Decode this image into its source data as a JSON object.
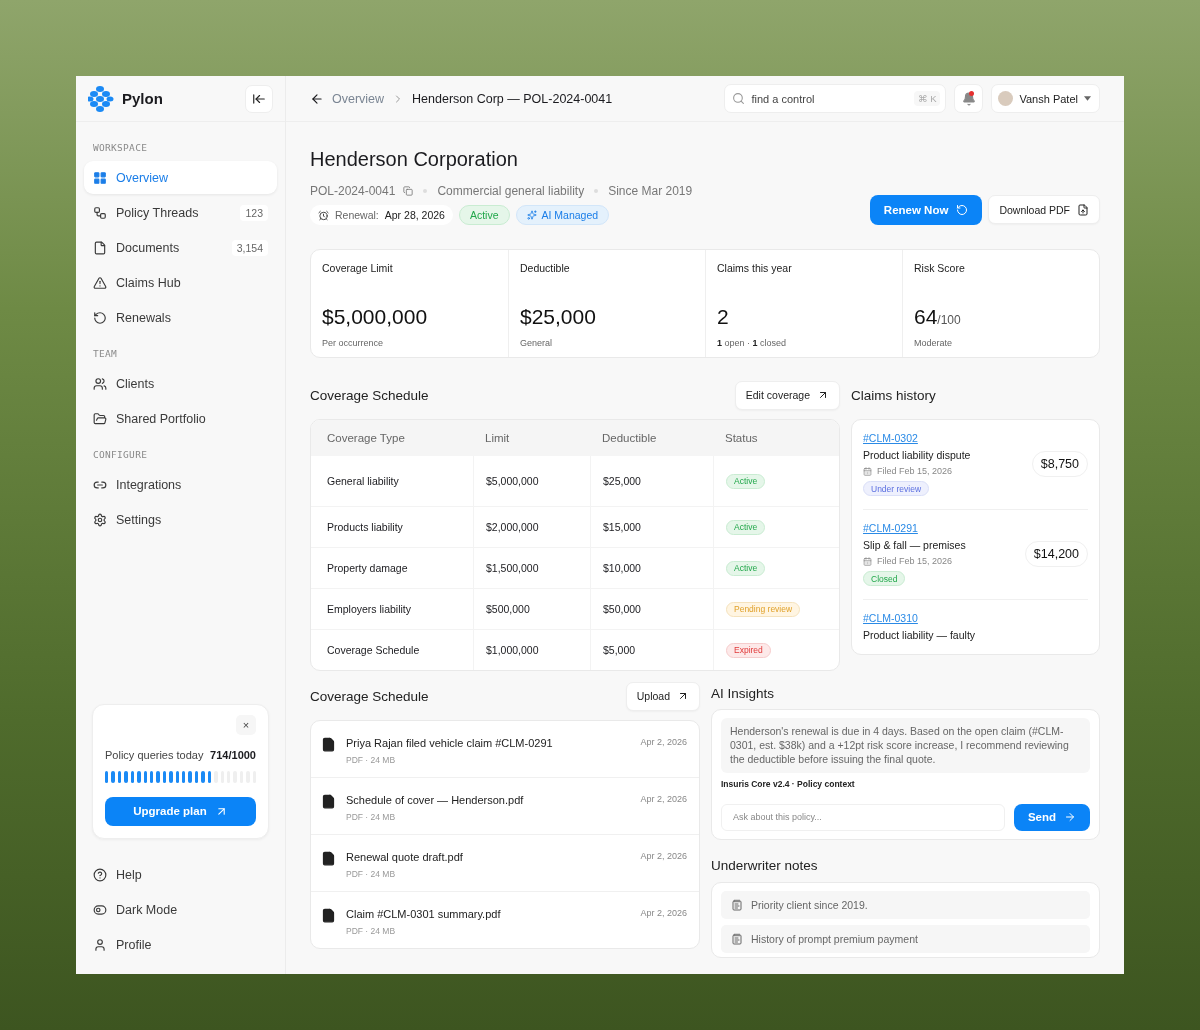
{
  "brand": {
    "name": "Pylon"
  },
  "sidebar": {
    "sections": [
      {
        "title": "WORKSPACE",
        "items": [
          {
            "label": "Overview",
            "selected": true
          },
          {
            "label": "Policy Threads",
            "count": "123",
            "selected": false
          },
          {
            "label": "Documents",
            "count": "3,154",
            "selected": false
          },
          {
            "label": "Claims Hub",
            "selected": false
          },
          {
            "label": "Renewals",
            "selected": false
          }
        ]
      },
      {
        "title": "TEAM",
        "items": [
          {
            "label": "Clients",
            "selected": false
          },
          {
            "label": "Shared Portfolio",
            "selected": false
          }
        ]
      },
      {
        "title": "CONFIGURE",
        "items": [
          {
            "label": "Integrations",
            "selected": false
          },
          {
            "label": "Settings",
            "selected": false
          }
        ]
      }
    ],
    "usage": {
      "close": "×",
      "label": "Policy queries today",
      "value": "714/1000",
      "level": 0.714,
      "button": "Upgrade plan"
    },
    "footer": [
      {
        "label": "Help"
      },
      {
        "label": "Dark Mode"
      },
      {
        "label": "Profile"
      }
    ]
  },
  "topbar": {
    "breadcrumb": [
      {
        "label": "Overview"
      },
      {
        "label": "Henderson Corp — POL-2024-0041"
      }
    ],
    "search": {
      "placeholder": "find a control",
      "shortcut": "⌘ K"
    },
    "notifications": {
      "unread": true
    },
    "user": {
      "name": "Vansh Patel"
    }
  },
  "header": {
    "title": "Henderson Corporation",
    "policy_id": "POL-2024-0041",
    "line": "Commercial general liability",
    "since": "Since Mar 2019",
    "renewal": {
      "label": "Renewal:",
      "value": "Apr 28, 2026"
    },
    "tags": [
      {
        "label": "Active",
        "kind": "success"
      },
      {
        "label": "AI Managed",
        "kind": "ai"
      }
    ],
    "buttons": [
      {
        "label": "Renew Now",
        "kind": "primary"
      },
      {
        "label": "Download PDF",
        "kind": "secondary"
      }
    ]
  },
  "stats": [
    {
      "label": "Coverage Limit",
      "value": "$5,000,000",
      "note": "Per occurrence"
    },
    {
      "label": "Deductible",
      "value": "$25,000",
      "note": "General"
    },
    {
      "label": "Claims this year",
      "value": "2",
      "note": "**1** open · **1** closed"
    },
    {
      "label": "Risk Score",
      "value": "64",
      "suffix": "/100",
      "note": "Moderate"
    }
  ],
  "coverage": {
    "title": "Coverage Schedule",
    "button": "Edit coverage",
    "columns": [
      "Coverage Type",
      "Limit",
      "Deductible",
      "Status"
    ],
    "rows": [
      {
        "type": "General liability",
        "limit": "$5,000,000",
        "deductible": "$25,000",
        "status": {
          "label": "Active",
          "kind": "success"
        }
      },
      {
        "type": "Products liability",
        "limit": "$2,000,000",
        "deductible": "$15,000",
        "status": {
          "label": "Active",
          "kind": "success"
        }
      },
      {
        "type": "Property damage",
        "limit": "$1,500,000",
        "deductible": "$10,000",
        "status": {
          "label": "Active",
          "kind": "success"
        }
      },
      {
        "type": "Employers liability",
        "limit": "$500,000",
        "deductible": "$50,000",
        "status": {
          "label": "Pending review",
          "kind": "warning"
        }
      },
      {
        "type": "Coverage Schedule",
        "limit": "$1,000,000",
        "deductible": "$5,000",
        "status": {
          "label": "Expired",
          "kind": "danger"
        }
      }
    ]
  },
  "claims": {
    "title": "Claims history",
    "items": [
      {
        "id": "#CLM-0302",
        "title": "Product liability dispute",
        "filed": "Filed Feb 15, 2026",
        "amount": "$8,750",
        "status": {
          "label": "Under review",
          "kind": "info"
        }
      },
      {
        "id": "#CLM-0291",
        "title": "Slip & fall — premises",
        "filed": "Filed Feb 15, 2026",
        "amount": "$14,200",
        "status": {
          "label": "Closed",
          "kind": "success"
        }
      },
      {
        "id": "#CLM-0310",
        "title": "Product liability — faulty"
      }
    ]
  },
  "documents": {
    "title": "Coverage Schedule",
    "button": "Upload",
    "items": [
      {
        "name": "Priya Rajan filed vehicle claim #CLM-0291",
        "meta": "PDF · 24 MB",
        "date": "Apr 2, 2026"
      },
      {
        "name": "Schedule of cover — Henderson.pdf",
        "meta": "PDF · 24 MB",
        "date": "Apr 2, 2026"
      },
      {
        "name": "Renewal quote draft.pdf",
        "meta": "PDF · 24 MB",
        "date": "Apr 2, 2026"
      },
      {
        "name": "Claim #CLM-0301 summary.pdf",
        "meta": "PDF · 24 MB",
        "date": "Apr 2, 2026"
      }
    ]
  },
  "ai_insights": {
    "title": "AI Insights",
    "message": "Henderson's renewal is due in 4 days. Based on the open claim (#CLM-0301, est. $38k) and a +12pt risk score increase, I recommend reviewing the deductible before issuing the final quote.",
    "source": "Insuris Core v2.4 · Policy context",
    "input": {
      "placeholder": "Ask about this policy..."
    },
    "send": "Send"
  },
  "underwriter_notes": {
    "title": "Underwriter notes",
    "items": [
      "Priority client since 2019.",
      "History of prompt premium payment"
    ]
  }
}
